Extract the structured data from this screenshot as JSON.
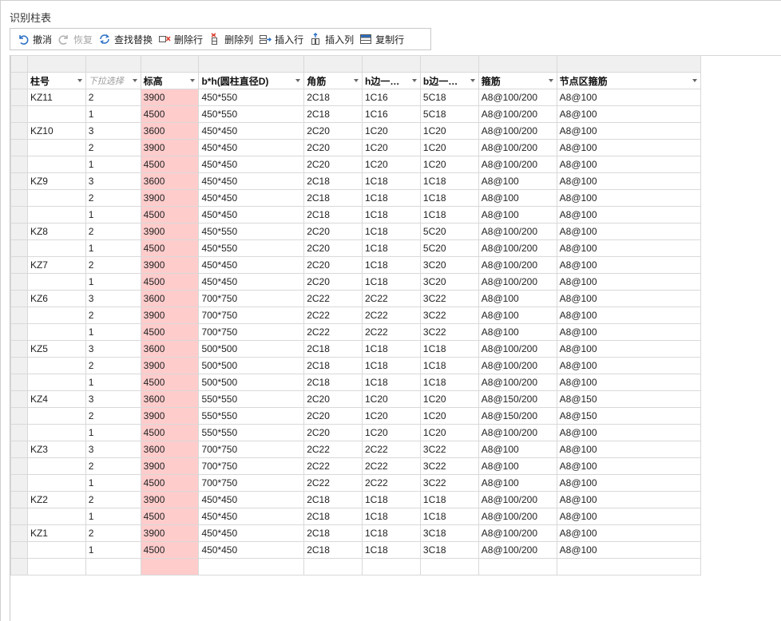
{
  "window": {
    "title": "识别柱表"
  },
  "toolbar": {
    "undo": "撤消",
    "redo": "恢复",
    "find_replace": "查找替换",
    "delete_row": "删除行",
    "delete_col": "删除列",
    "insert_row": "插入行",
    "insert_col": "插入列",
    "copy_row": "复制行"
  },
  "colors": {
    "elevation_highlight": "#ffcccc",
    "header_bg": "#f0f0f0",
    "grid_line": "#d9d9d9"
  },
  "table": {
    "headers": [
      "柱号",
      "下拉选择",
      "标高",
      "b*h(圆柱直径D)",
      "角筋",
      "h边一…",
      "b边一…",
      "箍筋",
      "节点区箍筋"
    ],
    "rows": [
      [
        "KZ11",
        "2",
        "3900",
        "450*550",
        "2C18",
        "1C16",
        "5C18",
        "A8@100/200",
        "A8@100"
      ],
      [
        "",
        "1",
        "4500",
        "450*550",
        "2C18",
        "1C16",
        "5C18",
        "A8@100/200",
        "A8@100"
      ],
      [
        "KZ10",
        "3",
        "3600",
        "450*450",
        "2C20",
        "1C20",
        "1C20",
        "A8@100/200",
        "A8@100"
      ],
      [
        "",
        "2",
        "3900",
        "450*450",
        "2C20",
        "1C20",
        "1C20",
        "A8@100/200",
        "A8@100"
      ],
      [
        "",
        "1",
        "4500",
        "450*450",
        "2C20",
        "1C20",
        "1C20",
        "A8@100/200",
        "A8@100"
      ],
      [
        "KZ9",
        "3",
        "3600",
        "450*450",
        "2C18",
        "1C18",
        "1C18",
        "A8@100",
        "A8@100"
      ],
      [
        "",
        "2",
        "3900",
        "450*450",
        "2C18",
        "1C18",
        "1C18",
        "A8@100",
        "A8@100"
      ],
      [
        "",
        "1",
        "4500",
        "450*450",
        "2C18",
        "1C18",
        "1C18",
        "A8@100",
        "A8@100"
      ],
      [
        "KZ8",
        "2",
        "3900",
        "450*550",
        "2C20",
        "1C18",
        "5C20",
        "A8@100/200",
        "A8@100"
      ],
      [
        "",
        "1",
        "4500",
        "450*550",
        "2C20",
        "1C18",
        "5C20",
        "A8@100/200",
        "A8@100"
      ],
      [
        "KZ7",
        "2",
        "3900",
        "450*450",
        "2C20",
        "1C18",
        "3C20",
        "A8@100/200",
        "A8@100"
      ],
      [
        "",
        "1",
        "4500",
        "450*450",
        "2C20",
        "1C18",
        "3C20",
        "A8@100/200",
        "A8@100"
      ],
      [
        "KZ6",
        "3",
        "3600",
        "700*750",
        "2C22",
        "2C22",
        "3C22",
        "A8@100",
        "A8@100"
      ],
      [
        "",
        "2",
        "3900",
        "700*750",
        "2C22",
        "2C22",
        "3C22",
        "A8@100",
        "A8@100"
      ],
      [
        "",
        "1",
        "4500",
        "700*750",
        "2C22",
        "2C22",
        "3C22",
        "A8@100",
        "A8@100"
      ],
      [
        "KZ5",
        "3",
        "3600",
        "500*500",
        "2C18",
        "1C18",
        "1C18",
        "A8@100/200",
        "A8@100"
      ],
      [
        "",
        "2",
        "3900",
        "500*500",
        "2C18",
        "1C18",
        "1C18",
        "A8@100/200",
        "A8@100"
      ],
      [
        "",
        "1",
        "4500",
        "500*500",
        "2C18",
        "1C18",
        "1C18",
        "A8@100/200",
        "A8@100"
      ],
      [
        "KZ4",
        "3",
        "3600",
        "550*550",
        "2C20",
        "1C20",
        "1C20",
        "A8@150/200",
        "A8@150"
      ],
      [
        "",
        "2",
        "3900",
        "550*550",
        "2C20",
        "1C20",
        "1C20",
        "A8@150/200",
        "A8@150"
      ],
      [
        "",
        "1",
        "4500",
        "550*550",
        "2C20",
        "1C20",
        "1C20",
        "A8@100/200",
        "A8@100"
      ],
      [
        "KZ3",
        "3",
        "3600",
        "700*750",
        "2C22",
        "2C22",
        "3C22",
        "A8@100",
        "A8@100"
      ],
      [
        "",
        "2",
        "3900",
        "700*750",
        "2C22",
        "2C22",
        "3C22",
        "A8@100",
        "A8@100"
      ],
      [
        "",
        "1",
        "4500",
        "700*750",
        "2C22",
        "2C22",
        "3C22",
        "A8@100",
        "A8@100"
      ],
      [
        "KZ2",
        "2",
        "3900",
        "450*450",
        "2C18",
        "1C18",
        "1C18",
        "A8@100/200",
        "A8@100"
      ],
      [
        "",
        "1",
        "4500",
        "450*450",
        "2C18",
        "1C18",
        "1C18",
        "A8@100/200",
        "A8@100"
      ],
      [
        "KZ1",
        "2",
        "3900",
        "450*450",
        "2C18",
        "1C18",
        "3C18",
        "A8@100/200",
        "A8@100"
      ],
      [
        "",
        "1",
        "4500",
        "450*450",
        "2C18",
        "1C18",
        "3C18",
        "A8@100/200",
        "A8@100"
      ],
      [
        "",
        "",
        "",
        "",
        "",
        "",
        "",
        "",
        ""
      ]
    ]
  }
}
